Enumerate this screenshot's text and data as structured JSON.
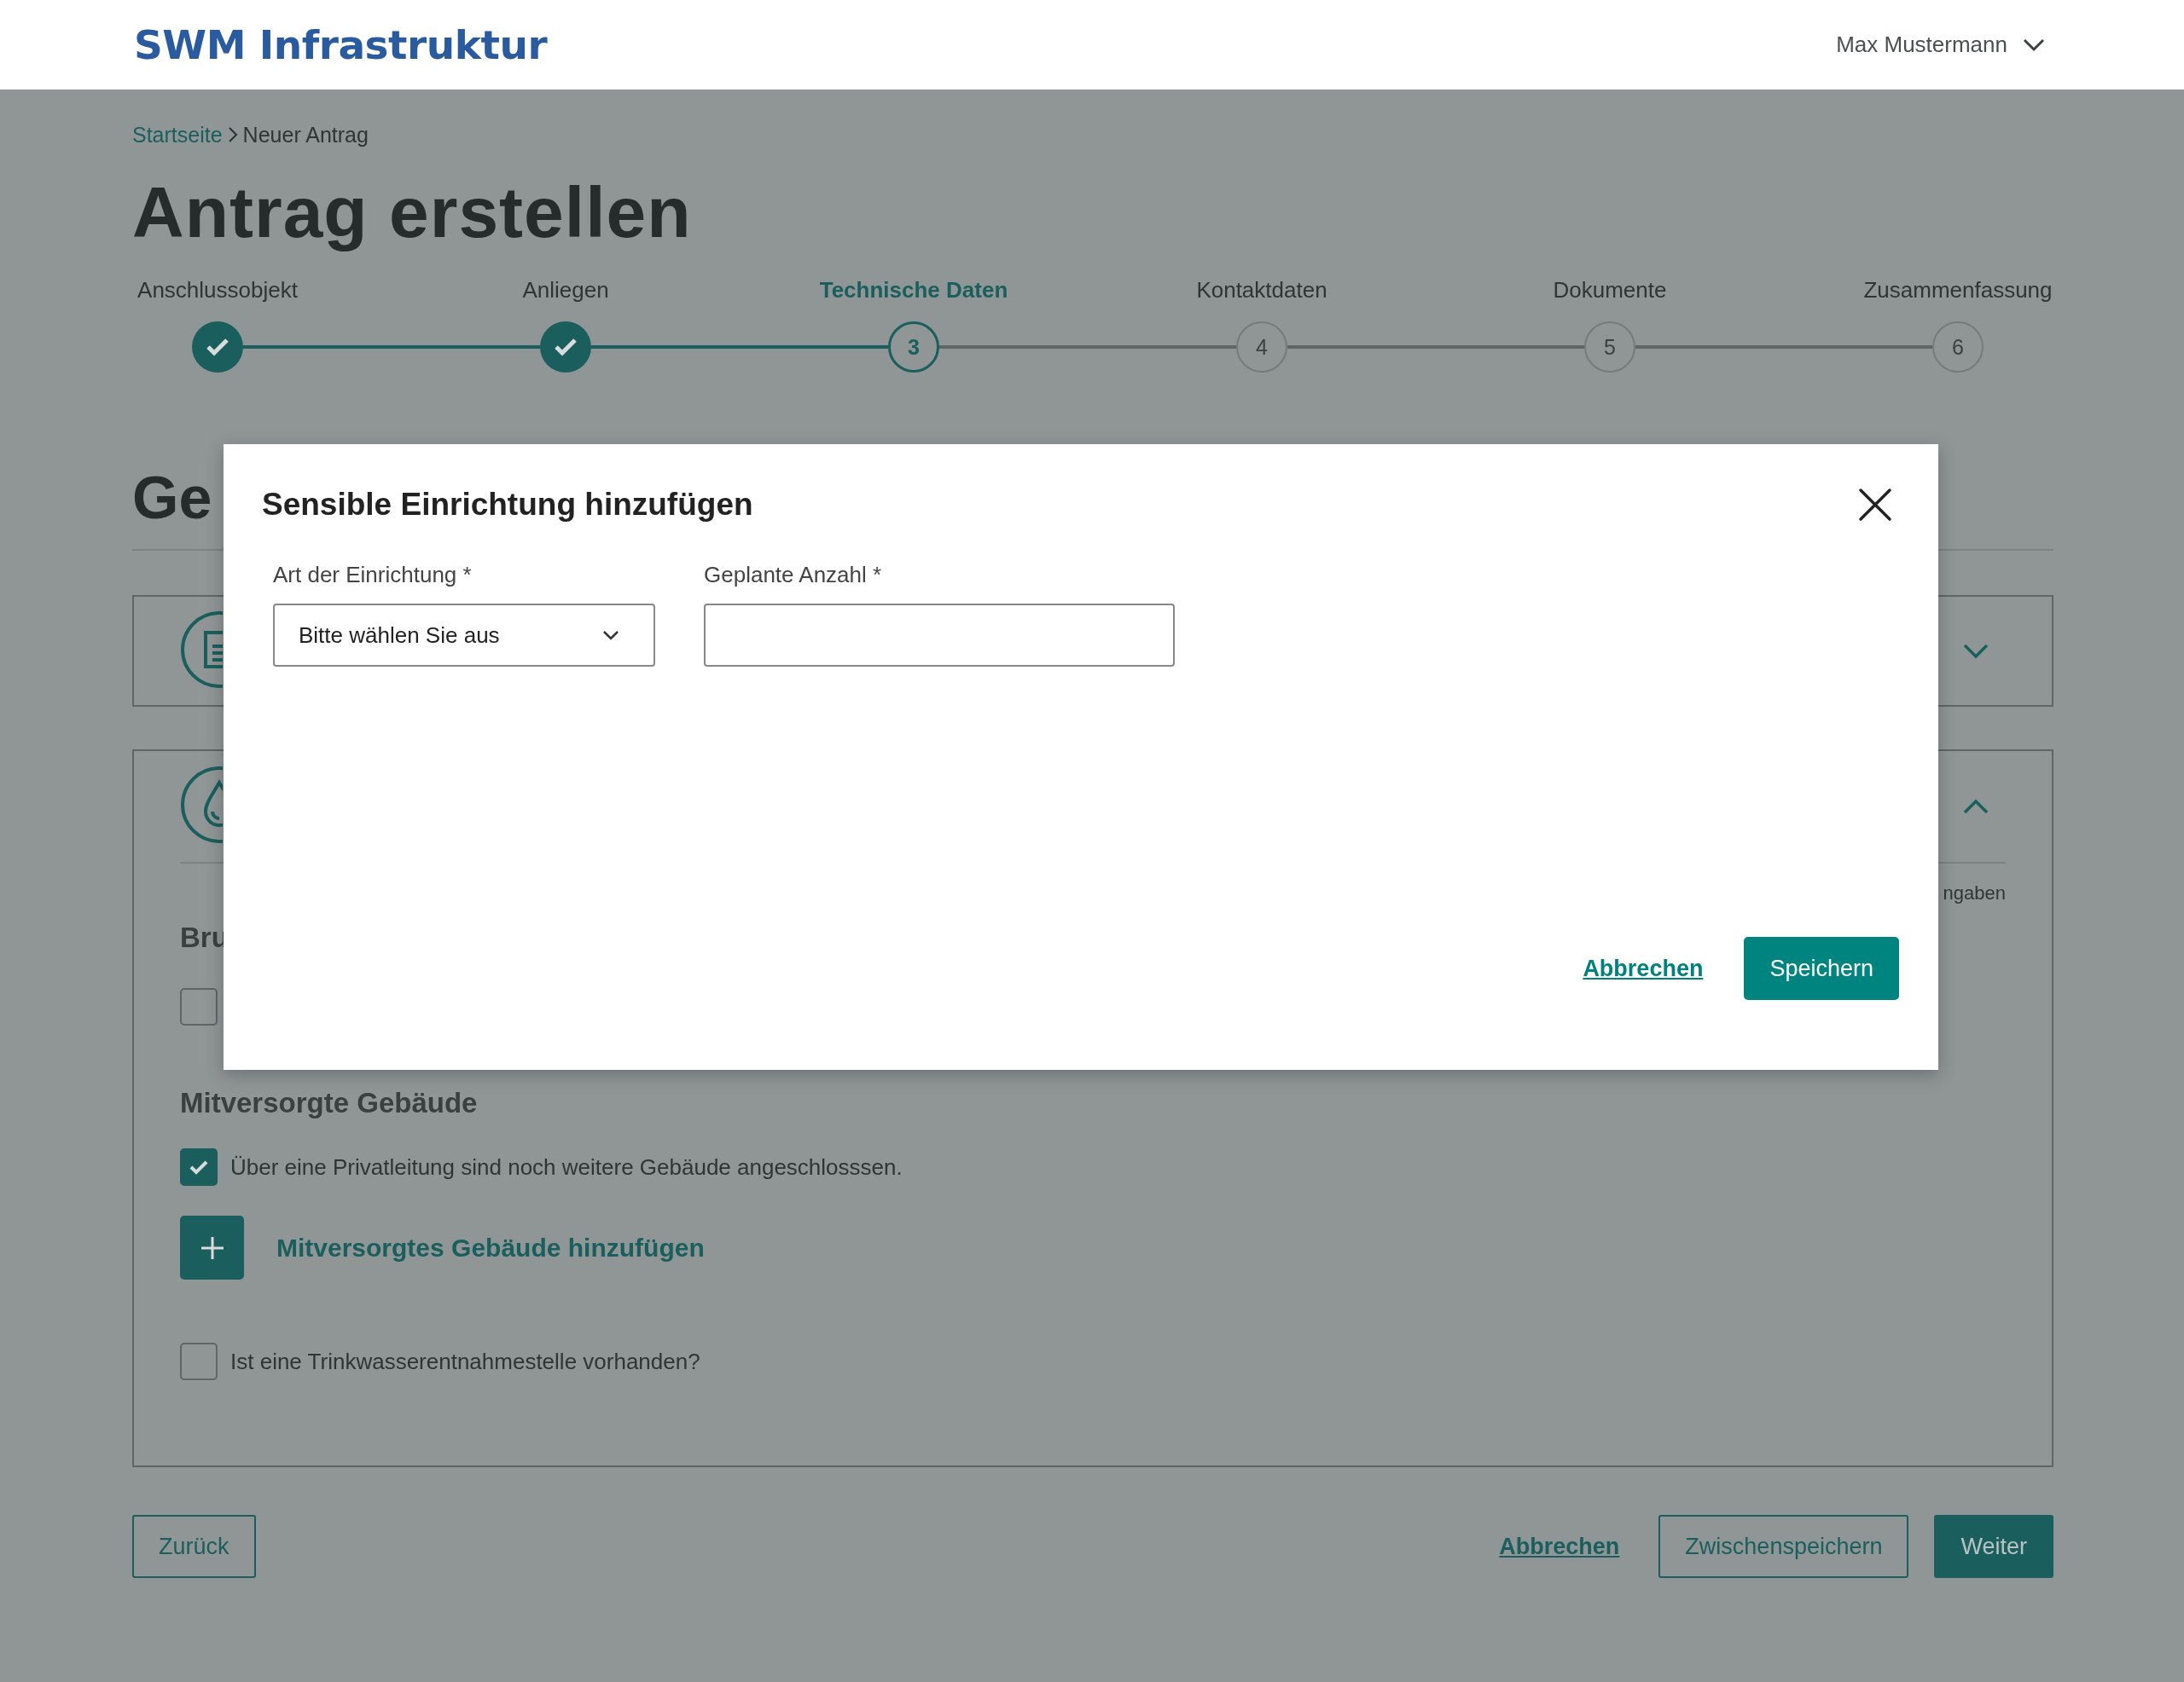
{
  "header": {
    "logo": "SWM Infrastruktur",
    "user": "Max Mustermann"
  },
  "breadcrumb": [
    {
      "label": "Startseite",
      "kind": "link"
    },
    {
      "label": "Neuer Antrag",
      "kind": "current"
    }
  ],
  "title": "Antrag erstellen",
  "steps": [
    {
      "label": "Anschlussobjekt",
      "done": true,
      "selected": false
    },
    {
      "label": "Anliegen",
      "done": true,
      "selected": false
    },
    {
      "label": "Technische Daten",
      "done": false,
      "selected": true,
      "number": "3"
    },
    {
      "label": "Kontaktdaten",
      "done": false,
      "selected": false,
      "number": "4"
    },
    {
      "label": "Dokumente",
      "done": false,
      "selected": false,
      "number": "5"
    },
    {
      "label": "Zusammenfassung",
      "done": false,
      "selected": false,
      "number": "6"
    }
  ],
  "section_heading": "Ge",
  "cards": [
    {
      "kind": "document",
      "expanded": false
    },
    {
      "kind": "drop",
      "expanded": true,
      "hint": "ngaben",
      "subheading": "Bru",
      "first_checkbox": {
        "checked": false
      },
      "group_heading": "Mitversorgte Gebäude",
      "co_supplied": {
        "label": "Über eine Privatleitung sind noch weitere Gebäude angeschlosssen.",
        "checked": true
      },
      "add_button": "Mitversorgtes Gebäude hinzufügen",
      "drinking_water": {
        "label": "Ist eine Trinkwasserentnahmestelle vorhanden?",
        "checked": false
      }
    }
  ],
  "footer": {
    "back": "Zurück",
    "cancel": "Abbrechen",
    "save_draft": "Zwischenspeichern",
    "next": "Weiter"
  },
  "modal": {
    "title": "Sensible Einrichtung hinzufügen",
    "fields": [
      {
        "kind": "select",
        "label": "Art der Einrichtung *",
        "placeholder": "Bitte wählen Sie aus"
      },
      {
        "kind": "text",
        "label": "Geplante Anzahl *"
      }
    ],
    "cancel": "Abbrechen",
    "save": "Speichern"
  }
}
